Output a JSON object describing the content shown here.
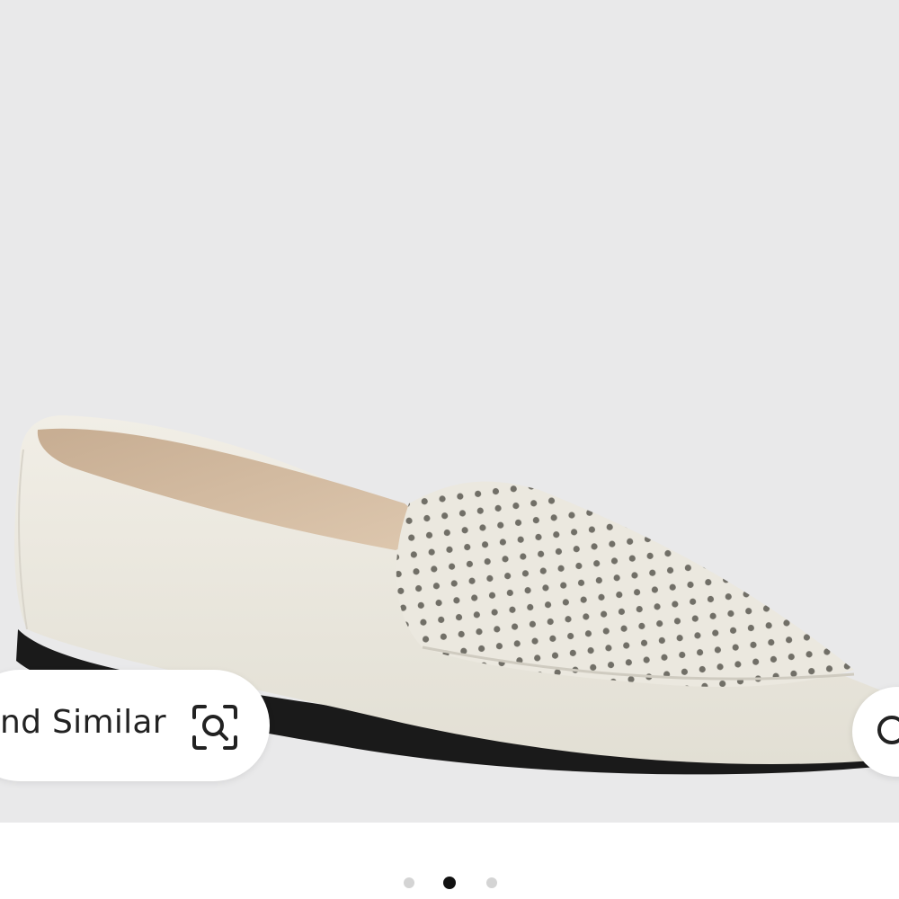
{
  "find_similar": {
    "label": "nd Similar",
    "icon": "scan-search-icon"
  },
  "carousel": {
    "total": 3,
    "active_index": 1
  },
  "colors": {
    "background": "#e9e9ea",
    "shoe": "#ece9df",
    "active_dot": "#111111",
    "inactive_dot": "#d4d4d4"
  }
}
